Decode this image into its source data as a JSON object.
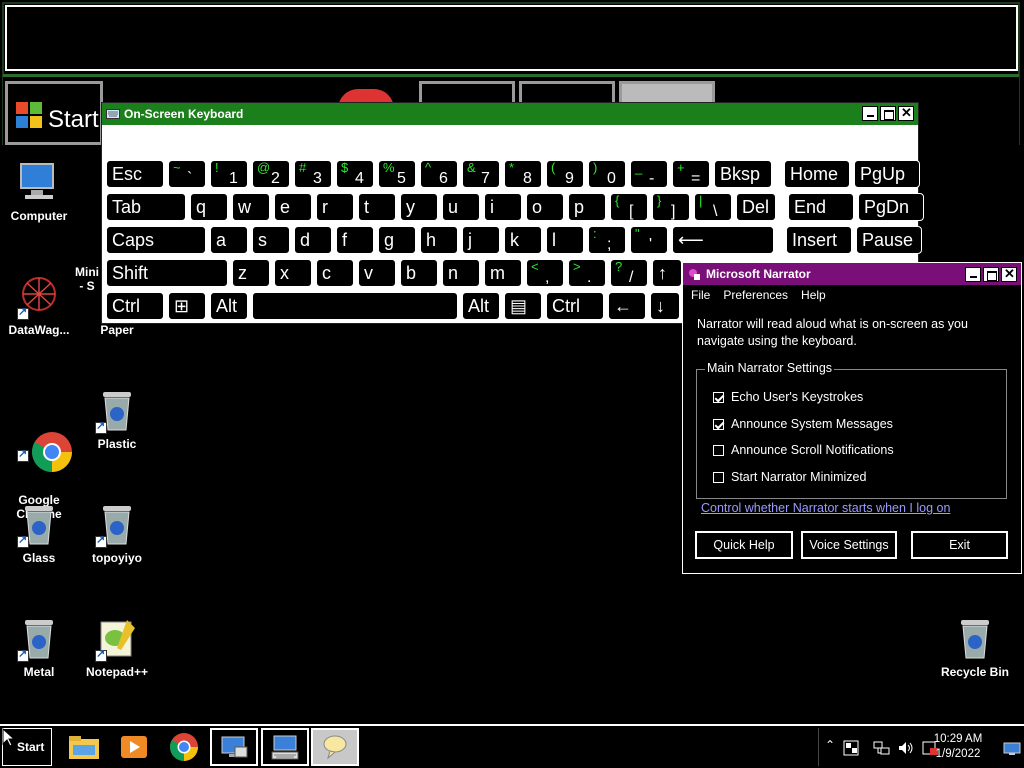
{
  "magnifier": {
    "start_label": "Start"
  },
  "osk": {
    "title": "On-Screen Keyboard",
    "rows": [
      [
        {
          "main": "Esc"
        },
        {
          "shift": "~",
          "base": "`"
        },
        {
          "shift": "!",
          "base": "1"
        },
        {
          "shift": "@",
          "base": "2"
        },
        {
          "shift": "#",
          "base": "3"
        },
        {
          "shift": "$",
          "base": "4"
        },
        {
          "shift": "%",
          "base": "5"
        },
        {
          "shift": "^",
          "base": "6"
        },
        {
          "shift": "&",
          "base": "7"
        },
        {
          "shift": "*",
          "base": "8"
        },
        {
          "shift": "(",
          "base": "9"
        },
        {
          "shift": ")",
          "base": "0"
        },
        {
          "shift": "_",
          "base": "-"
        },
        {
          "shift": "+",
          "base": "="
        },
        {
          "main": "Bksp"
        },
        {
          "main": "Home"
        },
        {
          "main": "PgUp"
        }
      ],
      [
        {
          "main": "Tab"
        },
        {
          "main": "q"
        },
        {
          "main": "w"
        },
        {
          "main": "e"
        },
        {
          "main": "r"
        },
        {
          "main": "t"
        },
        {
          "main": "y"
        },
        {
          "main": "u"
        },
        {
          "main": "i"
        },
        {
          "main": "o"
        },
        {
          "main": "p"
        },
        {
          "shift": "{",
          "base": "["
        },
        {
          "shift": "}",
          "base": "]"
        },
        {
          "shift": "|",
          "base": "\\"
        },
        {
          "main": "Del"
        },
        {
          "main": "End"
        },
        {
          "main": "PgDn"
        }
      ],
      [
        {
          "main": "Caps"
        },
        {
          "main": "a"
        },
        {
          "main": "s"
        },
        {
          "main": "d"
        },
        {
          "main": "f"
        },
        {
          "main": "g"
        },
        {
          "main": "h"
        },
        {
          "main": "j"
        },
        {
          "main": "k"
        },
        {
          "main": "l"
        },
        {
          "shift": ":",
          "base": ";"
        },
        {
          "shift": "\"",
          "base": "'"
        },
        {
          "main": "⟵"
        },
        {
          "main": "Insert"
        },
        {
          "main": "Pause"
        }
      ],
      [
        {
          "main": "Shift"
        },
        {
          "main": "z"
        },
        {
          "main": "x"
        },
        {
          "main": "c"
        },
        {
          "main": "v"
        },
        {
          "main": "b"
        },
        {
          "main": "n"
        },
        {
          "main": "m"
        },
        {
          "shift": "<",
          "base": ","
        },
        {
          "shift": ">",
          "base": "."
        },
        {
          "shift": "?",
          "base": "/"
        },
        {
          "main": "↑"
        }
      ],
      [
        {
          "main": "Ctrl"
        },
        {
          "main": "⊞"
        },
        {
          "main": "Alt"
        },
        {
          "main": ""
        },
        {
          "main": "Alt"
        },
        {
          "main": "▤"
        },
        {
          "main": "Ctrl"
        },
        {
          "main": "←"
        },
        {
          "main": "↓"
        }
      ]
    ]
  },
  "narrator": {
    "title": "Microsoft Narrator",
    "menu": [
      "File",
      "Preferences",
      "Help"
    ],
    "description": "Narrator will read aloud what is on-screen as you navigate using the keyboard.",
    "group_label": "Main Narrator Settings",
    "options": [
      {
        "label": "Echo User's Keystrokes",
        "checked": true
      },
      {
        "label": "Announce System Messages",
        "checked": true
      },
      {
        "label": "Announce Scroll Notifications",
        "checked": false
      },
      {
        "label": "Start Narrator Minimized",
        "checked": false
      }
    ],
    "link": "Control whether Narrator starts when I log on",
    "buttons": [
      "Quick Help",
      "Voice Settings",
      "Exit"
    ]
  },
  "desktop": {
    "icons": [
      {
        "label": "Computer",
        "icon": "computer-icon"
      },
      {
        "label": "Mini\n- S",
        "icon": "partial-icon"
      },
      {
        "label": "DataWag...",
        "icon": "datawag-icon"
      },
      {
        "label": "Paper",
        "icon": "paper-icon"
      },
      {
        "label": "Google\nChrome",
        "icon": "chrome-icon"
      },
      {
        "label": "Plastic",
        "icon": "recycle-icon"
      },
      {
        "label": "Glass",
        "icon": "recycle-icon"
      },
      {
        "label": "topoyiyo",
        "icon": "recycle-icon"
      },
      {
        "label": "Metal",
        "icon": "recycle-icon"
      },
      {
        "label": "Notepad++",
        "icon": "notepad-icon"
      },
      {
        "label": "Recycle Bin",
        "icon": "recycle-bin-icon"
      }
    ]
  },
  "taskbar": {
    "start_label": "Start",
    "apps": [
      "file-explorer-icon",
      "media-player-icon",
      "chrome-icon",
      "narrator-app-icon",
      "osk-app-icon",
      "speech-app-icon"
    ],
    "tray_icons": [
      "show-hidden-icon",
      "flag-icon",
      "network-icon",
      "volume-icon",
      "action-center-icon"
    ],
    "time": "10:29 AM",
    "date": "1/9/2022"
  }
}
